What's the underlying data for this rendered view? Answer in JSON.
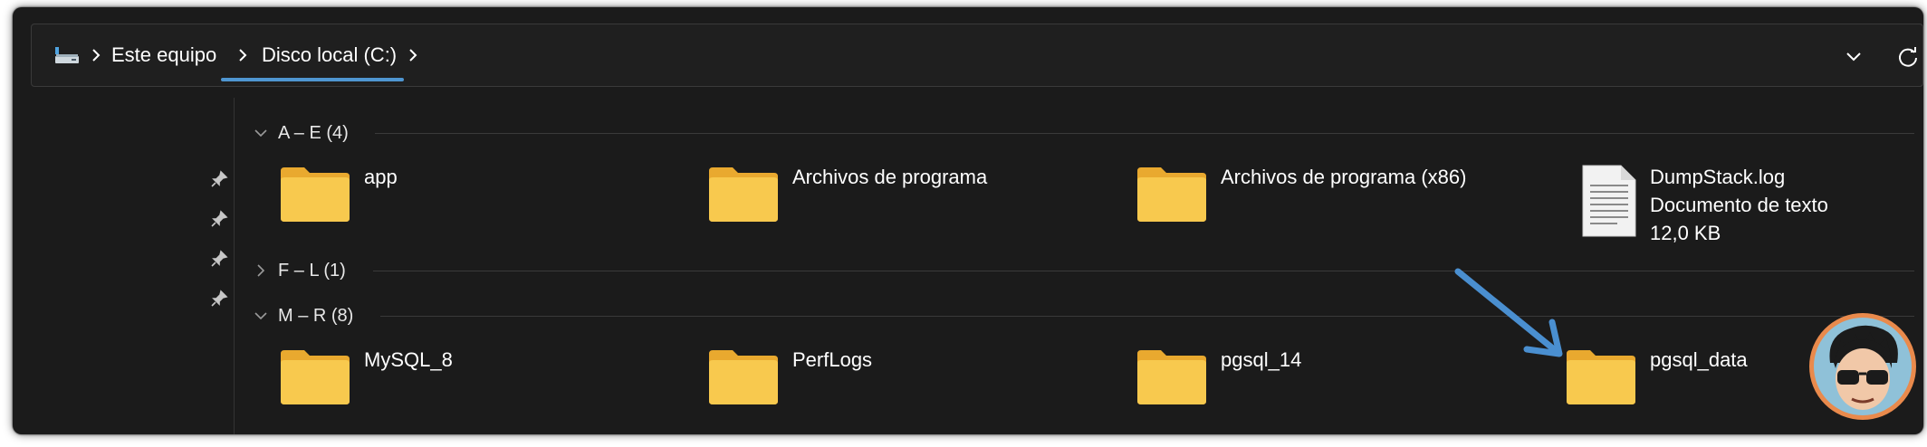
{
  "breadcrumb": {
    "items": [
      "Este equipo",
      "Disco local (C:)"
    ]
  },
  "icons": {
    "breadcrumb_root": "pc-drive-icon",
    "separator": "chevron-right-icon",
    "expand": "chevron-down-icon",
    "refresh": "refresh-icon",
    "pin": "pin-icon",
    "folder": "folder-icon",
    "text_file": "text-document-icon"
  },
  "groups": [
    {
      "label": "A – E (4)",
      "expanded": true,
      "items": [
        {
          "name": "app",
          "type": "folder"
        },
        {
          "name": "Archivos de programa",
          "type": "folder"
        },
        {
          "name": "Archivos de programa (x86)",
          "type": "folder"
        },
        {
          "name": "DumpStack.log",
          "type": "file",
          "kind": "Documento de texto",
          "size": "12,0 KB"
        }
      ]
    },
    {
      "label": "F – L (1)",
      "expanded": false,
      "items": []
    },
    {
      "label": "M – R (8)",
      "expanded": true,
      "items": [
        {
          "name": "MySQL_8",
          "type": "folder"
        },
        {
          "name": "PerfLogs",
          "type": "folder"
        },
        {
          "name": "pgsql_14",
          "type": "folder"
        },
        {
          "name": "pgsql_data",
          "type": "folder"
        }
      ]
    }
  ],
  "colors": {
    "background": "#1b1b1b",
    "accent": "#4f96d1",
    "folder": "#f8c94e",
    "arrow": "#4a8fd0",
    "avatar_ring": "#e98a4c"
  }
}
